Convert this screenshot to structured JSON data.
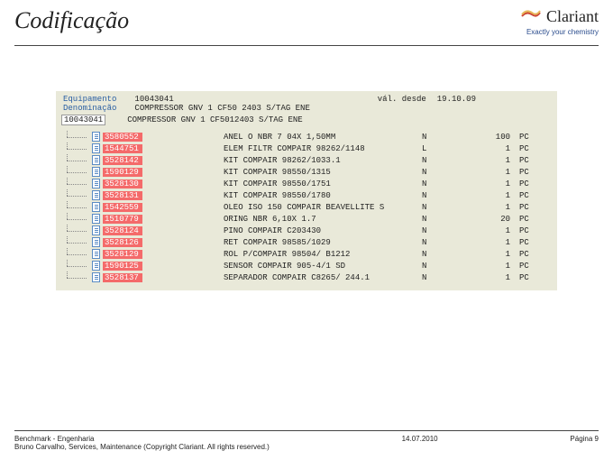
{
  "page": {
    "title": "Codificação",
    "brand_name": "Clariant",
    "brand_tag": "Exactly your chemistry"
  },
  "sap": {
    "label_equip": "Equipamento",
    "label_denom": "Denominação",
    "equip_id": "10043041",
    "equip_desc": "COMPRESSOR GNV 1 CF50 2403 S/TAG ENE",
    "valid_label": "vál. desde",
    "valid_value": "19.10.09",
    "root_id": "10043041",
    "root_desc": "COMPRESSOR GNV 1 CF5012403 S/TAG ENE",
    "items": [
      {
        "id": "3580552",
        "desc": "ANEL O NBR 7 04X 1,50MM",
        "n": "N",
        "qty": "100",
        "u": "PC"
      },
      {
        "id": "1544751",
        "desc": "ELEM FILTR COMPAIR 98262/1148",
        "n": "L",
        "qty": "1",
        "u": "PC"
      },
      {
        "id": "3528142",
        "desc": "KIT COMPAIR 98262/1033.1",
        "n": "N",
        "qty": "1",
        "u": "PC"
      },
      {
        "id": "1590129",
        "desc": "KIT COMPAIR 98550/1315",
        "n": "N",
        "qty": "1",
        "u": "PC"
      },
      {
        "id": "3528130",
        "desc": "KIT COMPAIR 98550/1751",
        "n": "N",
        "qty": "1",
        "u": "PC"
      },
      {
        "id": "3528131",
        "desc": "KIT COMPAIR 98550/1780",
        "n": "N",
        "qty": "1",
        "u": "PC"
      },
      {
        "id": "1542559",
        "desc": "OLEO ISO 150 COMPAIR BEAVELLITE S",
        "n": "N",
        "qty": "1",
        "u": "PC"
      },
      {
        "id": "1510779",
        "desc": "ORING NBR   6,10X 1.7",
        "n": "N",
        "qty": "20",
        "u": "PC"
      },
      {
        "id": "3528124",
        "desc": "PINO COMPAIR C203430",
        "n": "N",
        "qty": "1",
        "u": "PC"
      },
      {
        "id": "3528126",
        "desc": "RET COMPAIR 98585/1029",
        "n": "N",
        "qty": "1",
        "u": "PC"
      },
      {
        "id": "3528129",
        "desc": "ROL P/COMPAIR 98504/ B1212",
        "n": "N",
        "qty": "1",
        "u": "PC"
      },
      {
        "id": "1590125",
        "desc": "SENSOR COMPAIR 905-4/1 SD",
        "n": "N",
        "qty": "1",
        "u": "PC"
      },
      {
        "id": "3528137",
        "desc": "SEPARADOR COMPAIR C8265/ 244.1",
        "n": "N",
        "qty": "1",
        "u": "PC"
      }
    ]
  },
  "footer": {
    "line1": "Benchmark - Engenharia",
    "line2": "Bruno Carvalho, Services, Maintenance (Copyright Clariant. All rights reserved.)",
    "date": "14.07.2010",
    "page": "Página 9"
  }
}
